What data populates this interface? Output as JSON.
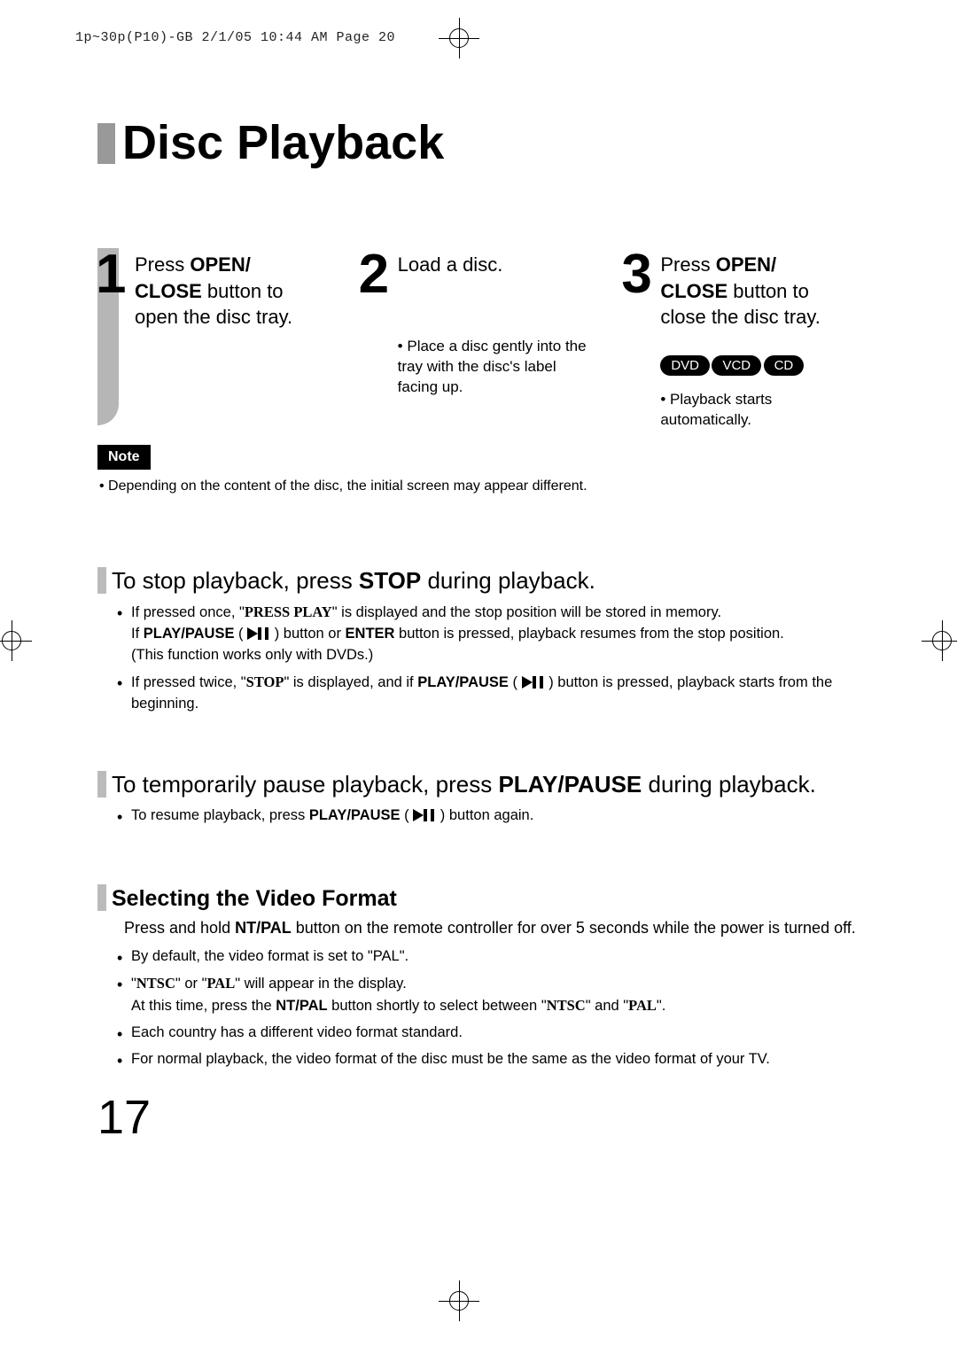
{
  "header_line": "1p~30p(P10)-GB  2/1/05 10:44 AM  Page 20",
  "main_title": "Disc Playback",
  "steps": {
    "s1": {
      "num": "1",
      "line1_a": "Press ",
      "line1_b": "OPEN/",
      "line2_a": "CLOSE",
      "line2_b": " button to",
      "line3": "open the disc tray."
    },
    "s2": {
      "num": "2",
      "line1": "Load a disc.",
      "sub1": "Place a disc gently into the tray with the disc's label facing up."
    },
    "s3": {
      "num": "3",
      "line1_a": "Press ",
      "line1_b": "OPEN/",
      "line2_a": "CLOSE",
      "line2_b": " button to",
      "line3": "close the disc tray.",
      "pill1": "DVD",
      "pill2": "VCD",
      "pill3": "CD",
      "sub1": "Playback starts automatically."
    }
  },
  "note": {
    "tag": "Note",
    "text": "Depending on the content of the disc, the initial screen may appear different."
  },
  "sec_stop": {
    "head_a": "To stop playback, press ",
    "head_b": "STOP",
    "head_c": " during playback.",
    "b1_a": "If pressed once, \"",
    "b1_b": "PRESS PLAY",
    "b1_c": "\" is displayed and the stop position will be stored in memory.",
    "b1_line2_a": "If ",
    "b1_line2_b": "PLAY/PAUSE",
    "b1_line2_c": " ( ",
    "b1_line2_d": " ) button or ",
    "b1_line2_e": "ENTER",
    "b1_line2_f": " button is pressed, playback resumes from the stop position.",
    "b1_line3": "(This function works only with DVDs.)",
    "b2_a": "If pressed twice, \"",
    "b2_b": "STOP",
    "b2_c": "\" is displayed, and if ",
    "b2_d": "PLAY/PAUSE",
    "b2_e": " ( ",
    "b2_f": " ) button is pressed, playback starts from the beginning."
  },
  "sec_pause": {
    "head_a": "To temporarily pause playback, press ",
    "head_b": "PLAY/PAUSE",
    "head_c": " during playback.",
    "b1_a": "To resume playback, press ",
    "b1_b": "PLAY/PAUSE",
    "b1_c": " ( ",
    "b1_d": " ) button again."
  },
  "sec_vfmt": {
    "head": "Selecting the Video Format",
    "intro_a": "Press and hold ",
    "intro_b": "NT/PAL",
    "intro_c": " button on the remote controller for over 5 seconds while the power is turned off.",
    "b1": "By default, the video format is set to \"PAL\".",
    "b2_a": "\"",
    "b2_b": "NTSC",
    "b2_c": "\" or \"",
    "b2_d": "PAL",
    "b2_e": "\" will appear in the display.",
    "b2_line2_a": "At this time, press the ",
    "b2_line2_b": "NT/PAL",
    "b2_line2_c": " button shortly to select between \"",
    "b2_line2_d": "NTSC",
    "b2_line2_e": "\" and \"",
    "b2_line2_f": "PAL",
    "b2_line2_g": "\".",
    "b3": "Each country has a different video format standard.",
    "b4": "For normal playback, the video format of the disc must be the same as the video format of your TV."
  },
  "page_number": "17"
}
